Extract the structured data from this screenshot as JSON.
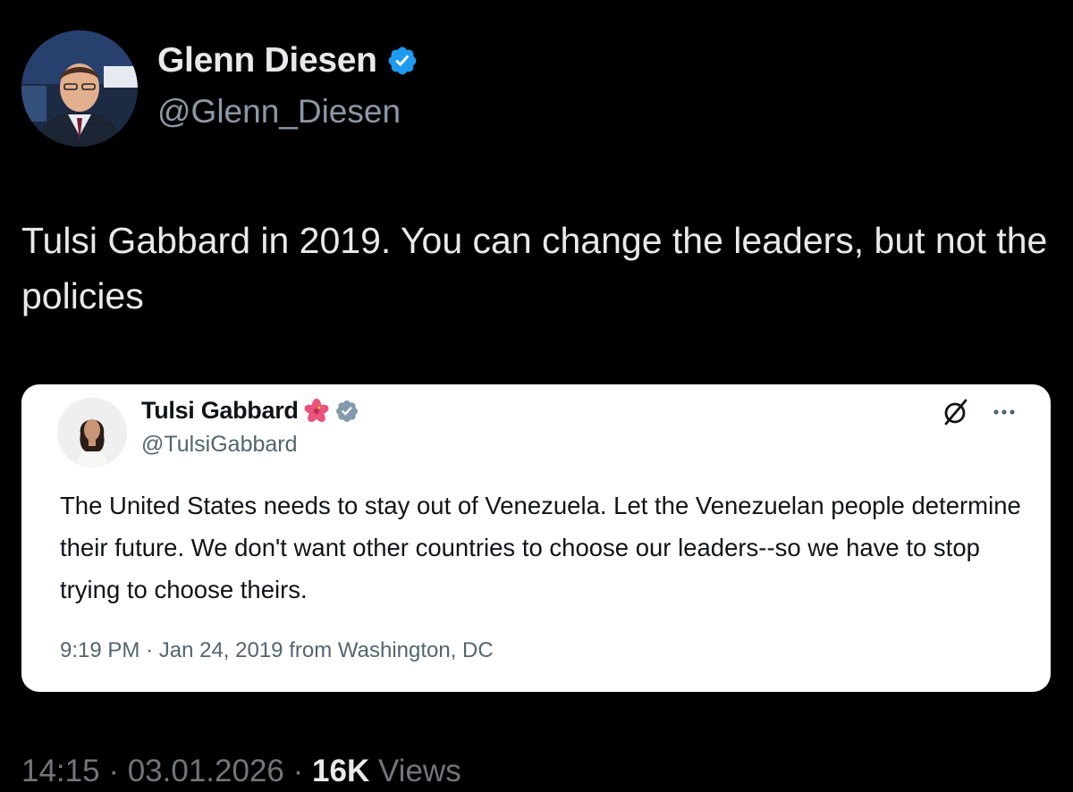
{
  "author": {
    "name": "Glenn Diesen",
    "handle": "@Glenn_Diesen",
    "avatar_icon": "person-avatar",
    "verified_icon": "verified-badge-icon",
    "verified_color": "#1d9bf0"
  },
  "tweet": {
    "text": "Tulsi Gabbard in 2019. You can change the leaders, but not the policies"
  },
  "quoted_tweet": {
    "name": "Tulsi Gabbard",
    "emoji_icon": "hibiscus-icon",
    "handle": "@TulsiGabbard",
    "verified_icon": "government-verified-badge-icon",
    "verified_color": "#829aab",
    "text": "The United States needs to stay out of Venezuela. Let the Venezuelan people determine their future. We don't want other countries to choose our leaders--so we have to stop trying to choose theirs.",
    "time": "9:19 PM",
    "separator": "·",
    "date": "Jan 24, 2019",
    "source": "from Washington, DC"
  },
  "meta": {
    "time": "14:15",
    "separator": "·",
    "date": "03.01.2026",
    "views_count": "16K",
    "views_label": "Views"
  },
  "colors": {
    "background": "#000000",
    "primary_text": "#e7e9ea",
    "secondary_text": "#71767b",
    "card_background": "#ffffff"
  }
}
